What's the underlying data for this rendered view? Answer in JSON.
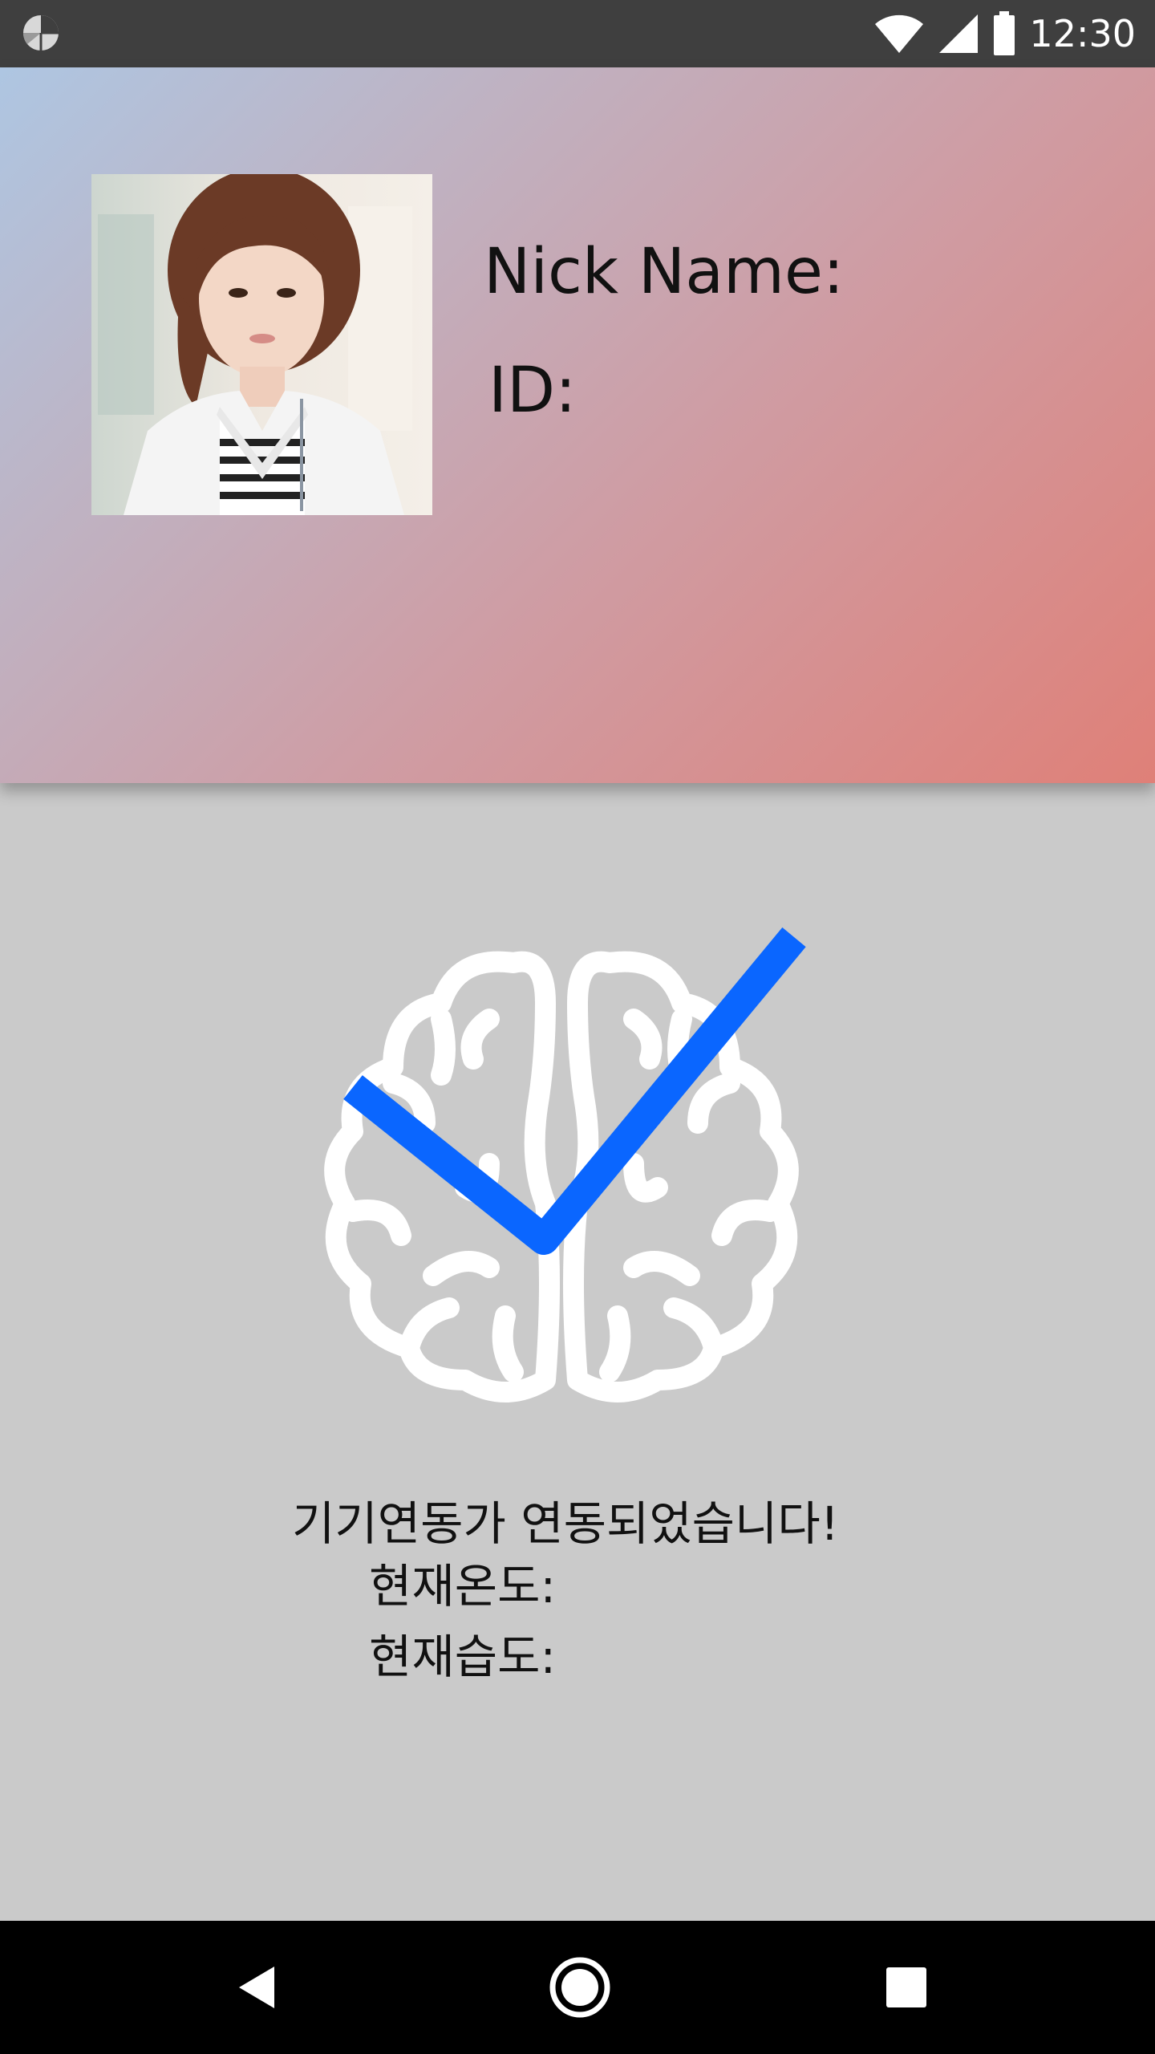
{
  "status_bar": {
    "time": "12:30",
    "icons": [
      "app-icon",
      "wifi-icon",
      "signal-icon",
      "battery-icon"
    ]
  },
  "profile": {
    "nick_name_label": "Nick Name:",
    "id_label": "ID:",
    "photo": "profile-photo"
  },
  "device": {
    "status_message": "기기연동가 연동되었습니다!",
    "temperature_label": "현재온도:",
    "humidity_label": "현재습도:",
    "icon": "brain-check-icon"
  },
  "nav_bar": {
    "icons": [
      "back-icon",
      "home-icon",
      "recents-icon"
    ]
  },
  "colors": {
    "status_bar": "#3f3f3f",
    "background": "#cacaca",
    "gradient_start": "#aec6e2",
    "gradient_end": "#df8078",
    "check_blue": "#0a66ff",
    "nav_bar": "#000000"
  }
}
